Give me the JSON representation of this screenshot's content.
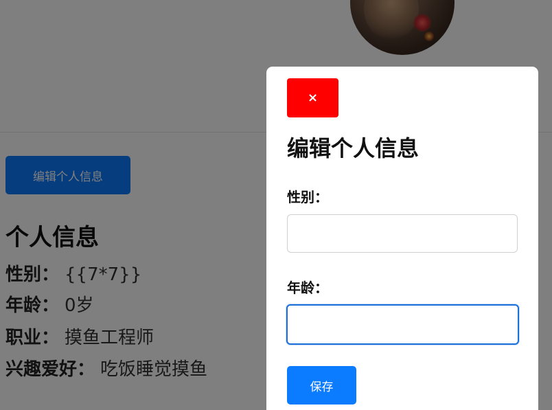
{
  "profile": {
    "edit_button_label": "编辑个人信息",
    "info_title": "个人信息",
    "fields": [
      {
        "key": "性别：",
        "value": "{{7*7}}"
      },
      {
        "key": "年龄：",
        "value": "0岁"
      },
      {
        "key": "职业：",
        "value": "摸鱼工程师"
      },
      {
        "key": "兴趣爱好：",
        "value": "吃饭睡觉摸鱼"
      }
    ]
  },
  "modal": {
    "close_label": "×",
    "title": "编辑个人信息",
    "gender_label": "性别：",
    "gender_value": "",
    "age_label": "年龄：",
    "age_value": "",
    "save_label": "保存"
  },
  "colors": {
    "primary": "#0b7bff",
    "close": "#ff0000",
    "focus": "#1c6fd8"
  }
}
